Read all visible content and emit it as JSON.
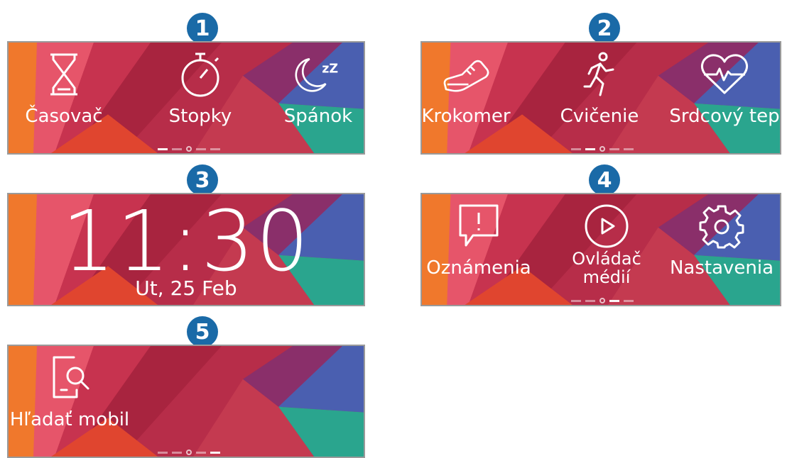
{
  "colors": {
    "badge": "#1a6aa7",
    "base": "#b52a46",
    "orange": "#f0782c",
    "pink": "#e44d6a",
    "blue": "#4a5fb0",
    "teal": "#2aa58e"
  },
  "panel1": {
    "number": "1",
    "items": [
      {
        "icon": "hourglass-icon",
        "label": "Časovač"
      },
      {
        "icon": "stopwatch-icon",
        "label": "Stopky"
      },
      {
        "icon": "moon-sleep-icon",
        "label": "Spánok"
      }
    ]
  },
  "panel2": {
    "number": "2",
    "items": [
      {
        "icon": "shoe-icon",
        "label": "Krokomer"
      },
      {
        "icon": "running-person-icon",
        "label": "Cvičenie"
      },
      {
        "icon": "heart-rate-icon",
        "label": "Srdcový tep"
      }
    ]
  },
  "panel3": {
    "number": "3",
    "time": "11:30",
    "date": "Ut, 25 Feb"
  },
  "panel4": {
    "number": "4",
    "items": [
      {
        "icon": "notification-icon",
        "label": "Oznámenia"
      },
      {
        "icon": "play-icon",
        "label_line1": "Ovládač",
        "label_line2": "médií"
      },
      {
        "icon": "gear-icon",
        "label": "Nastavenia"
      }
    ]
  },
  "panel5": {
    "number": "5",
    "items": [
      {
        "icon": "find-phone-icon",
        "label": "Hľadať mobil"
      }
    ]
  }
}
